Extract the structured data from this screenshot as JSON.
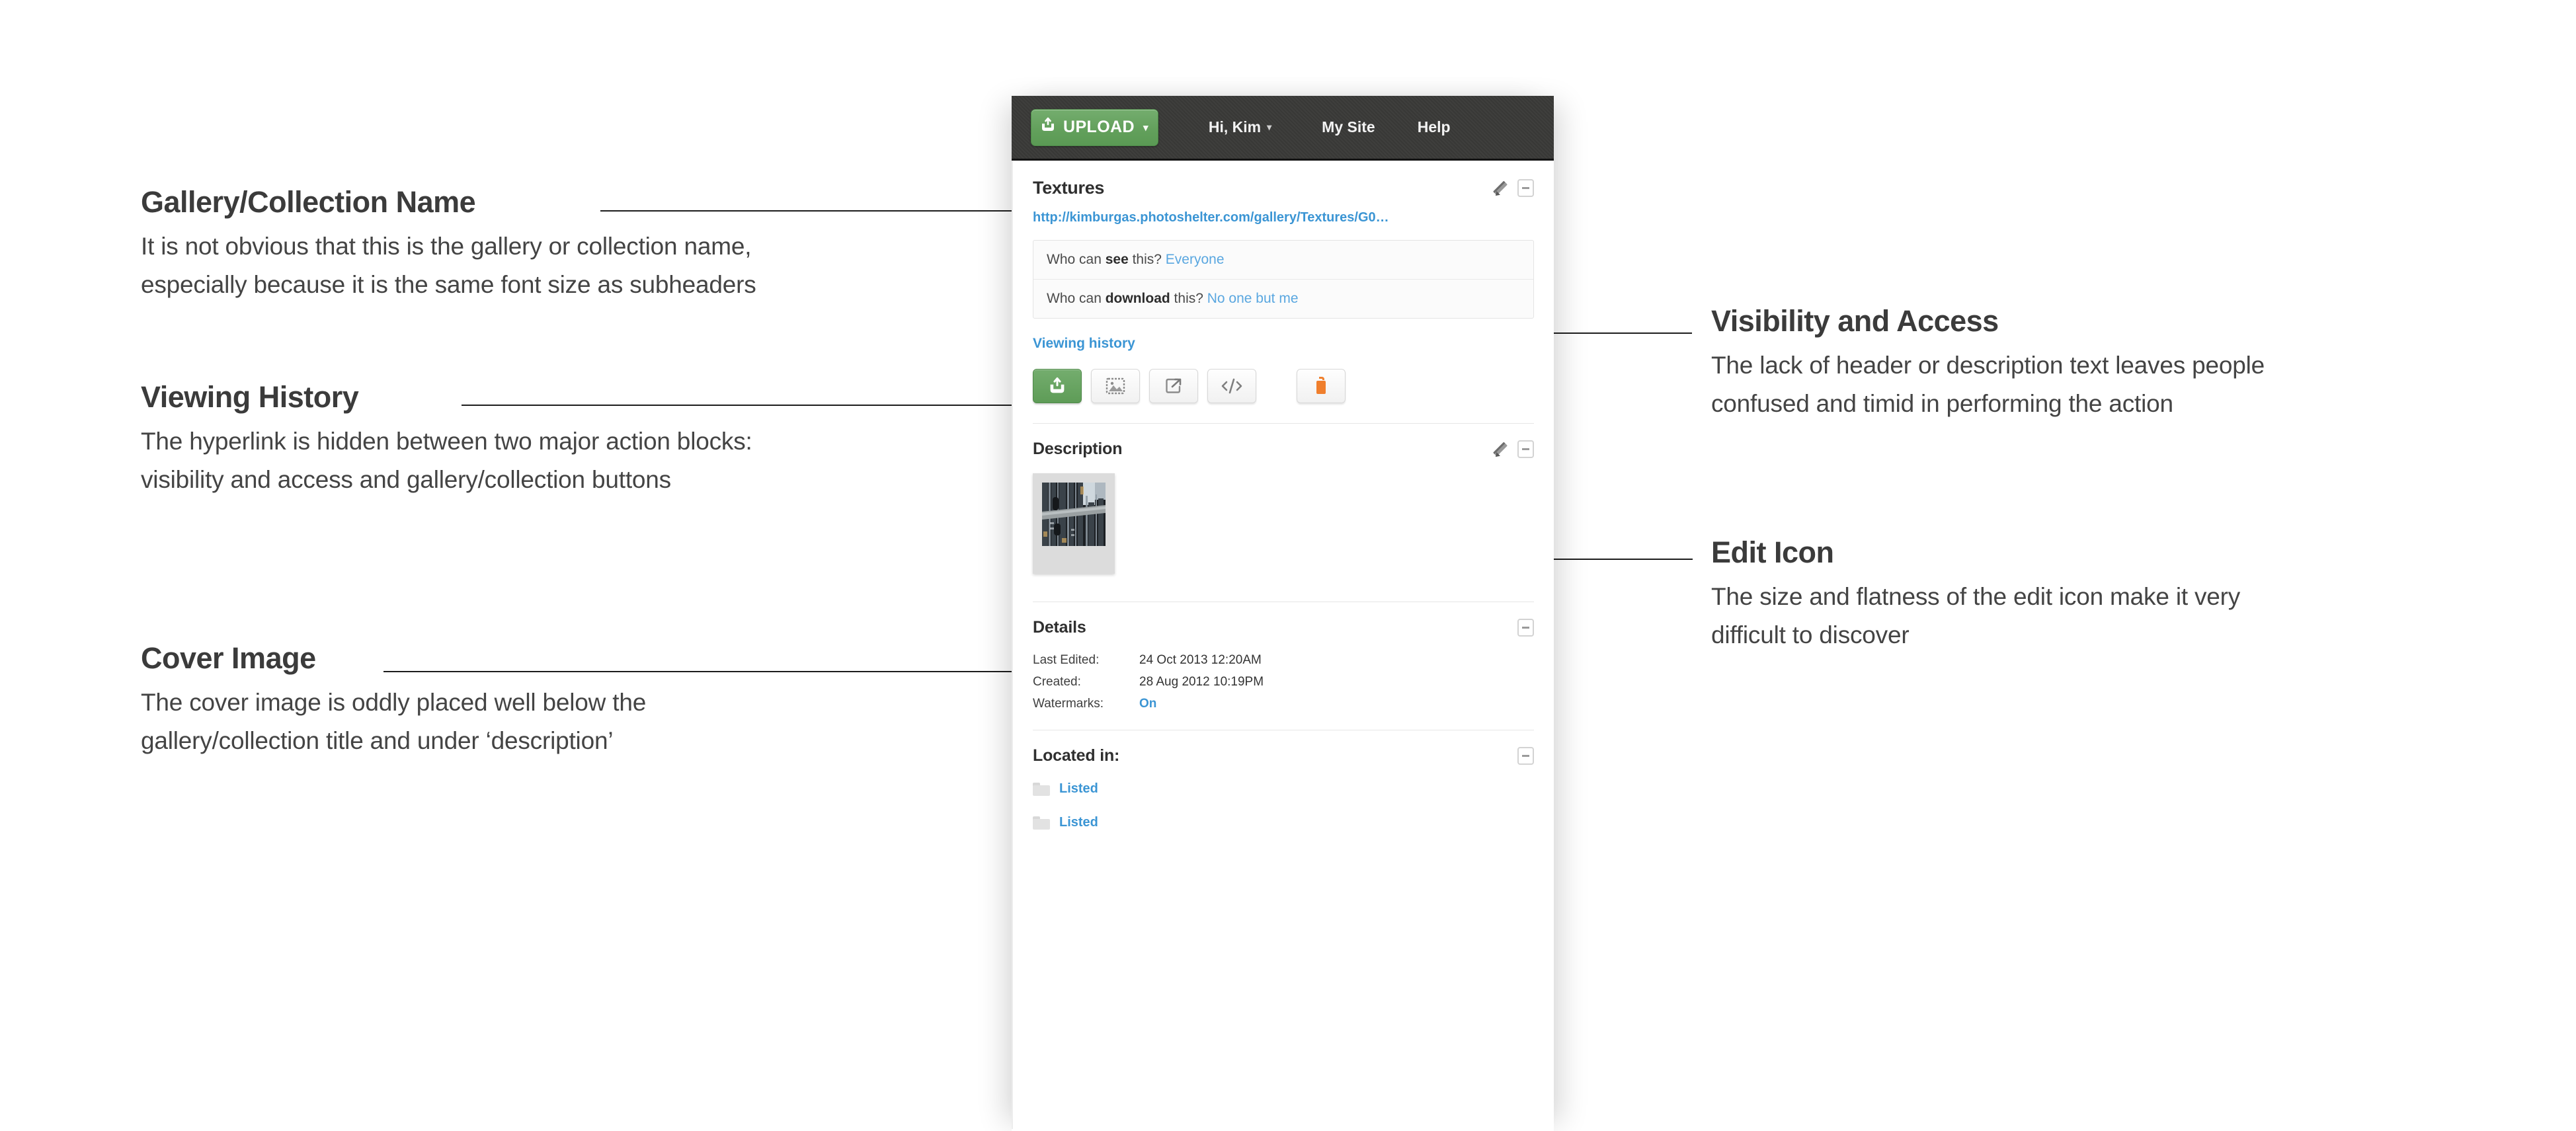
{
  "app": {
    "topnav": {
      "upload_label": "UPLOAD",
      "upload_caret": "▾",
      "upload_icon": "upload-icon",
      "greeting": "Hi, Kim",
      "greeting_caret": "▾",
      "my_site": "My Site",
      "help": "Help"
    },
    "gallery": {
      "name": "Textures",
      "url": "http://kimburgas.photoshelter.com/gallery/Textures/G0…",
      "edit_icon": "pencil-icon",
      "collapse_icon": "collapse-icon"
    },
    "visibility": {
      "see_question": "Who can ",
      "see_bold": "see",
      "see_tail": " this? ",
      "see_value": "Everyone",
      "download_question": "Who can ",
      "download_bold": "download",
      "download_tail": " this? ",
      "download_value": "No one but me"
    },
    "viewing_history_label": "Viewing history",
    "actions": [
      {
        "name": "upload-button",
        "icon": "upload-icon",
        "style": "green"
      },
      {
        "name": "cover-image-button",
        "icon": "image-icon",
        "style": "plain"
      },
      {
        "name": "share-button",
        "icon": "share-icon",
        "style": "plain"
      },
      {
        "name": "embed-code-button",
        "icon": "embed-code-icon",
        "style": "plain"
      },
      {
        "name": "delete-button",
        "icon": "trash-icon",
        "style": "plain"
      }
    ],
    "description": {
      "heading": "Description",
      "edit_icon": "pencil-icon",
      "collapse_icon": "collapse-icon"
    },
    "details": {
      "heading": "Details",
      "collapse_icon": "collapse-icon",
      "rows": [
        {
          "label": "Last Edited:",
          "value": "24 Oct 2013 12:20AM",
          "is_link": false
        },
        {
          "label": "Created:",
          "value": "28 Aug 2012 10:19PM",
          "is_link": false
        },
        {
          "label": "Watermarks:",
          "value": "On",
          "is_link": true
        }
      ]
    },
    "located_in": {
      "heading": "Located in:",
      "collapse_icon": "collapse-icon",
      "items": [
        {
          "label": "Listed",
          "icon": "folder-icon"
        },
        {
          "label": "Listed",
          "icon": "folder-icon"
        }
      ]
    }
  },
  "annotations": [
    {
      "id": "gallery-collection-name",
      "title": "Gallery/Collection Name",
      "lines": [
        "It is not obvious that this is the gallery or collection name,",
        "especially because it is the same font size as subheaders"
      ]
    },
    {
      "id": "viewing-history",
      "title": "Viewing History",
      "lines": [
        "The hyperlink is hidden between two major action blocks:",
        "visibility and access and gallery/collection buttons"
      ]
    },
    {
      "id": "cover-image",
      "title": "Cover Image",
      "lines": [
        "The cover image is oddly placed well below the",
        "gallery/collection title and under ‘description’"
      ]
    },
    {
      "id": "visibility-and-access",
      "title": "Visibility and Access",
      "lines": [
        "The lack of header or description text leaves people",
        "confused and timid in performing the action"
      ]
    },
    {
      "id": "edit-icon",
      "title": "Edit Icon",
      "lines": [
        "The size and flatness of the edit icon make it very",
        "difficult to discover"
      ]
    }
  ],
  "colors": {
    "brand_green": "#63a05c",
    "link_blue": "#3b95d4",
    "delete_orange": "#f07f2d",
    "nav_dark": "#3a3a38",
    "text_dark": "#3b3b3b"
  }
}
